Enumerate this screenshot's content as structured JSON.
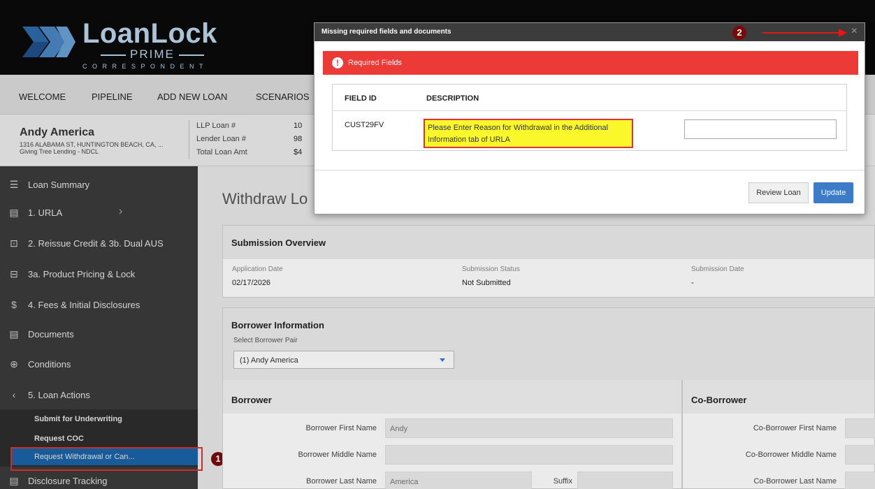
{
  "header": {
    "logo_name": "LoanLock",
    "logo_prime": "PRIME",
    "logo_corr": "CORRESPONDENT"
  },
  "nav": {
    "items": [
      "WELCOME",
      "PIPELINE",
      "ADD NEW LOAN",
      "SCENARIOS"
    ]
  },
  "loan_header": {
    "borrower_name": "Andy America",
    "address": "1316 ALABAMA ST, HUNTINGTON BEACH, CA, ...",
    "lender": "Giving Tree Lending - NDCL",
    "labels": [
      "LLP Loan #",
      "Lender Loan #",
      "Total Loan Amt"
    ],
    "values": [
      "10",
      "98",
      "$4"
    ]
  },
  "sidebar": {
    "items": [
      {
        "label": "Loan Summary",
        "icon": "list-icon"
      },
      {
        "label": "1. URLA",
        "icon": "form-icon"
      },
      {
        "label": "2. Reissue Credit & 3b. Dual AUS",
        "icon": "chip-icon"
      },
      {
        "label": "3a. Product Pricing & Lock",
        "icon": "lock-icon"
      },
      {
        "label": "4. Fees & Initial Disclosures",
        "icon": "dollar-icon"
      },
      {
        "label": "Documents",
        "icon": "document-icon"
      },
      {
        "label": "Conditions",
        "icon": "network-icon"
      },
      {
        "label": "5. Loan Actions",
        "icon": "chevron-left-icon"
      },
      {
        "label": "Disclosure Tracking",
        "icon": "document-icon"
      }
    ],
    "sub_items": [
      "Submit for Underwriting",
      "Request COC",
      "Request Withdrawal or Can..."
    ]
  },
  "annotations": {
    "badge_1": "1",
    "badge_2": "2"
  },
  "main": {
    "page_title": "Withdraw Lo",
    "submission": {
      "title": "Submission Overview",
      "labels": [
        "Application Date",
        "Submission Status",
        "Submission Date"
      ],
      "values": [
        "02/17/2026",
        "Not Submitted",
        "-"
      ]
    },
    "borrower_info": {
      "title": "Borrower Information",
      "select_label": "Select Borrower Pair",
      "select_value": "(1) Andy America"
    },
    "borrower": {
      "title": "Borrower",
      "first_name_label": "Borrower First Name",
      "first_name_value": "Andy",
      "middle_name_label": "Borrower Middle Name",
      "last_name_label": "Borrower Last Name",
      "last_name_value": "America",
      "suffix_label": "Suffix"
    },
    "coborrower": {
      "title": "Co-Borrower",
      "first_name_label": "Co-Borrower First Name",
      "middle_name_label": "Co-Borrower Middle Name",
      "last_name_label": "Co-Borrower Last Name"
    }
  },
  "modal": {
    "title": "Missing required fields and documents",
    "close_glyph": "×",
    "alert_icon": "!",
    "alert_text": "Required Fields",
    "col_field_id": "FIELD ID",
    "col_description": "DESCRIPTION",
    "row": {
      "field_id": "CUST29FV",
      "description_line1": "Please Enter Reason for Withdrawal in the Additional",
      "description_line2": "Information tab of URLA"
    },
    "review_button": "Review Loan",
    "update_button": "Update"
  }
}
